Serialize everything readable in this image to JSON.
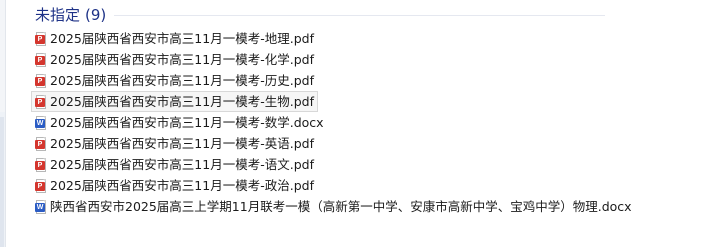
{
  "group": {
    "title": "未指定",
    "count": "(9)"
  },
  "files": [
    {
      "name": "2025届陕西省西安市高三11月一模考-地理.pdf",
      "type": "pdf",
      "badge": "P",
      "icon": "pdf-file-icon",
      "hover": false
    },
    {
      "name": "2025届陕西省西安市高三11月一模考-化学.pdf",
      "type": "pdf",
      "badge": "P",
      "icon": "pdf-file-icon",
      "hover": false
    },
    {
      "name": "2025届陕西省西安市高三11月一模考-历史.pdf",
      "type": "pdf",
      "badge": "P",
      "icon": "pdf-file-icon",
      "hover": false
    },
    {
      "name": "2025届陕西省西安市高三11月一模考-生物.pdf",
      "type": "pdf",
      "badge": "P",
      "icon": "pdf-file-icon",
      "hover": true
    },
    {
      "name": "2025届陕西省西安市高三11月一模考-数学.docx",
      "type": "docx",
      "badge": "W",
      "icon": "word-file-icon",
      "hover": false
    },
    {
      "name": "2025届陕西省西安市高三11月一模考-英语.pdf",
      "type": "pdf",
      "badge": "P",
      "icon": "pdf-file-icon",
      "hover": false
    },
    {
      "name": "2025届陕西省西安市高三11月一模考-语文.pdf",
      "type": "pdf",
      "badge": "P",
      "icon": "pdf-file-icon",
      "hover": false
    },
    {
      "name": "2025届陕西省西安市高三11月一模考-政治.pdf",
      "type": "pdf",
      "badge": "P",
      "icon": "pdf-file-icon",
      "hover": false
    },
    {
      "name": "陕西省西安市2025届高三上学期11月联考一模（高新第一中学、安康市高新中学、宝鸡中学）物理.docx",
      "type": "docx",
      "badge": "W",
      "icon": "word-file-icon",
      "hover": false
    }
  ],
  "colors": {
    "group_title": "#1e3287",
    "pdf_badge": "#d4362e",
    "word_badge": "#2b5cc4"
  }
}
